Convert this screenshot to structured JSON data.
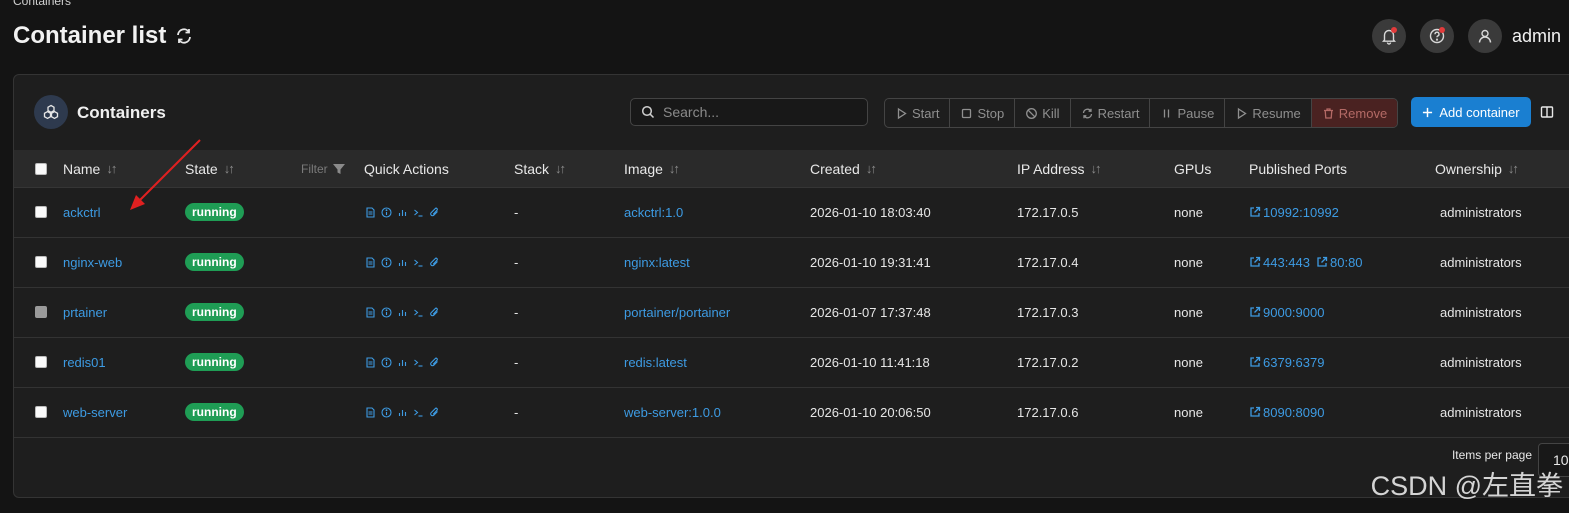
{
  "breadcrumb": "Containers",
  "page_title": "Container list",
  "user": {
    "name": "admin"
  },
  "panel": {
    "title": "Containers",
    "search_placeholder": "Search...",
    "actions": {
      "start": "Start",
      "stop": "Stop",
      "kill": "Kill",
      "restart": "Restart",
      "pause": "Pause",
      "resume": "Resume",
      "remove": "Remove"
    },
    "add_label": "Add container"
  },
  "table": {
    "headers": {
      "name": "Name",
      "state": "State",
      "filter": "Filter",
      "quick_actions": "Quick Actions",
      "stack": "Stack",
      "image": "Image",
      "created": "Created",
      "ip": "IP Address",
      "gpus": "GPUs",
      "ports": "Published Ports",
      "ownership": "Ownership"
    },
    "rows": [
      {
        "name": "ackctrl",
        "state": "running",
        "stack": "-",
        "image": "ackctrl:1.0",
        "created": "2026-01-10 18:03:40",
        "ip": "172.17.0.5",
        "gpus": "none",
        "ports": [
          "10992:10992"
        ],
        "ownership": "administrators"
      },
      {
        "name": "nginx-web",
        "state": "running",
        "stack": "-",
        "image": "nginx:latest",
        "created": "2026-01-10 19:31:41",
        "ip": "172.17.0.4",
        "gpus": "none",
        "ports": [
          "443:443",
          "80:80"
        ],
        "ownership": "administrators"
      },
      {
        "name": "prtainer",
        "state": "running",
        "stack": "-",
        "image": "portainer/portainer",
        "created": "2026-01-07 17:37:48",
        "ip": "172.17.0.3",
        "gpus": "none",
        "ports": [
          "9000:9000"
        ],
        "ownership": "administrators"
      },
      {
        "name": "redis01",
        "state": "running",
        "stack": "-",
        "image": "redis:latest",
        "created": "2026-01-10 11:41:18",
        "ip": "172.17.0.2",
        "gpus": "none",
        "ports": [
          "6379:6379"
        ],
        "ownership": "administrators"
      },
      {
        "name": "web-server",
        "state": "running",
        "stack": "-",
        "image": "web-server:1.0.0",
        "created": "2026-01-10 20:06:50",
        "ip": "172.17.0.6",
        "gpus": "none",
        "ports": [
          "8090:8090"
        ],
        "ownership": "administrators"
      }
    ]
  },
  "footer": {
    "items_per_page_label": "Items per page",
    "items_per_page_value": "10"
  },
  "watermark": "CSDN @左直拳",
  "colors": {
    "accent": "#1a7fd1",
    "running": "#1f9d55",
    "link": "#3d9be3",
    "annotation_arrow": "#e02020"
  }
}
